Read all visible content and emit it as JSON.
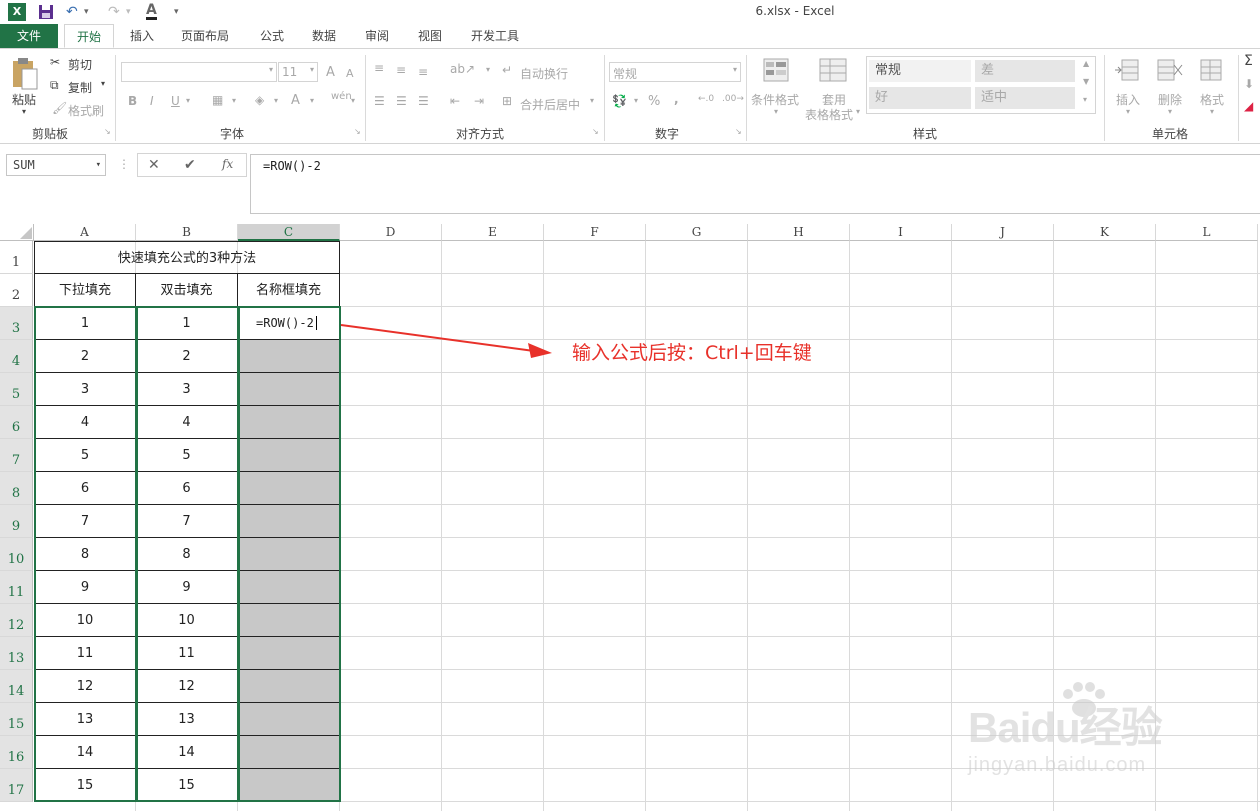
{
  "window": {
    "title": "6.xlsx - Excel"
  },
  "qat": {
    "font_a": "A"
  },
  "tabs": [
    "文件",
    "开始",
    "插入",
    "页面布局",
    "公式",
    "数据",
    "审阅",
    "视图",
    "开发工具"
  ],
  "ribbon": {
    "clipboard": {
      "paste": "粘贴",
      "cut": "剪切",
      "copy": "复制",
      "format_painter": "格式刷",
      "label": "剪贴板"
    },
    "font": {
      "size": "11",
      "bold": "B",
      "italic": "I",
      "underline": "U",
      "label": "字体",
      "inc": "A",
      "dec": "A",
      "color_a": "A",
      "phonetic": "wén"
    },
    "alignment": {
      "wrap": "自动换行",
      "merge": "合并后居中",
      "label": "对齐方式"
    },
    "number": {
      "format": "常规",
      "percent": "%",
      "comma": ",",
      "label": "数字"
    },
    "styles": {
      "cond": "条件格式",
      "table1": "套用",
      "table2": "表格格式",
      "normal": "常规",
      "bad": "差",
      "good": "好",
      "neutral": "适中",
      "label": "样式"
    },
    "cells": {
      "insert": "插入",
      "delete": "删除",
      "format": "格式",
      "label": "单元格"
    }
  },
  "formula_bar": {
    "name_box": "SUM",
    "content": "=ROW()-2",
    "cancel": "✕",
    "enter": "✔",
    "fx": "fx"
  },
  "columns": [
    "A",
    "B",
    "C",
    "D",
    "E",
    "F",
    "G",
    "H",
    "I",
    "J",
    "K",
    "L"
  ],
  "rows": [
    "1",
    "2",
    "3",
    "4",
    "5",
    "6",
    "7",
    "8",
    "9",
    "10",
    "11",
    "12",
    "13",
    "14",
    "15",
    "16",
    "17"
  ],
  "table": {
    "title": "快速填充公式的3种方法",
    "headers": [
      "下拉填充",
      "双击填充",
      "名称框填充"
    ],
    "col_a": [
      "1",
      "2",
      "3",
      "4",
      "5",
      "6",
      "7",
      "8",
      "9",
      "10",
      "11",
      "12",
      "13",
      "14",
      "15"
    ],
    "col_b": [
      "1",
      "2",
      "3",
      "4",
      "5",
      "6",
      "7",
      "8",
      "9",
      "10",
      "11",
      "12",
      "13",
      "14",
      "15"
    ],
    "active_cell_edit": "=ROW()-2"
  },
  "annotation": {
    "text": "输入公式后按：Ctrl+回车键",
    "color": "#e8312a"
  },
  "watermark": {
    "logo": "Baidu经验",
    "url": "jingyan.baidu.com"
  },
  "colors": {
    "excel_green": "#217346",
    "selection_fill": "#c8c8c8"
  }
}
